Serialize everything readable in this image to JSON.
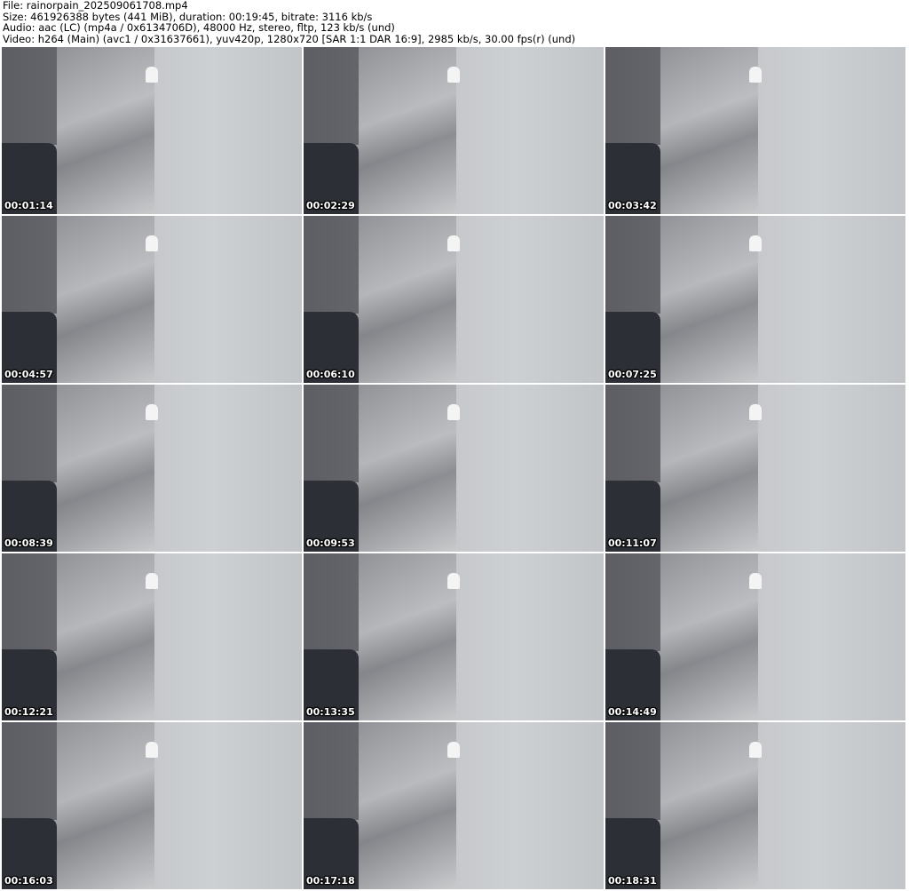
{
  "header": {
    "file": "File: rainorpain_202509061708.mp4",
    "size": "Size: 461926388 bytes (441 MiB), duration: 00:19:45, bitrate: 3116 kb/s",
    "audio": "Audio: aac (LC) (mp4a / 0x6134706D), 48000 Hz, stereo, fltp, 123 kb/s (und)",
    "video": "Video: h264 (Main) (avc1 / 0x31637661), yuv420p, 1280x720 [SAR 1:1 DAR 16:9], 2985 kb/s, 30.00 fps(r) (und)"
  },
  "thumbnails": [
    {
      "time": "00:01:14"
    },
    {
      "time": "00:02:29"
    },
    {
      "time": "00:03:42"
    },
    {
      "time": "00:04:57"
    },
    {
      "time": "00:06:10"
    },
    {
      "time": "00:07:25"
    },
    {
      "time": "00:08:39"
    },
    {
      "time": "00:09:53"
    },
    {
      "time": "00:11:07"
    },
    {
      "time": "00:12:21"
    },
    {
      "time": "00:13:35"
    },
    {
      "time": "00:14:49"
    },
    {
      "time": "00:16:03"
    },
    {
      "time": "00:17:18"
    },
    {
      "time": "00:18:31"
    }
  ]
}
